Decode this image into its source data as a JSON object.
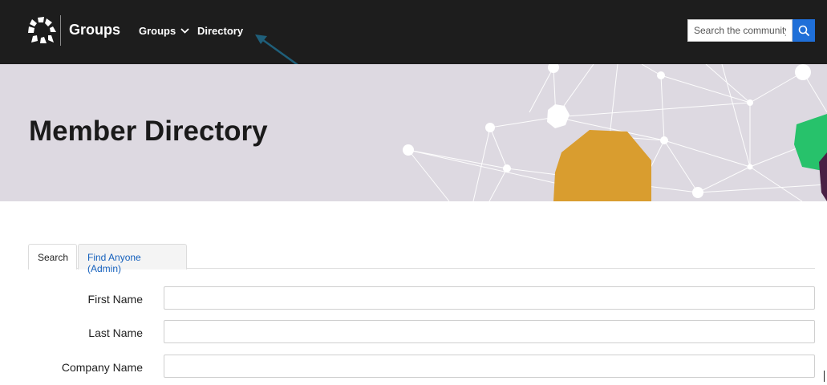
{
  "header": {
    "brand": "Groups",
    "nav": [
      {
        "label": "Groups",
        "has_dropdown": true
      },
      {
        "label": "Directory",
        "has_dropdown": false
      }
    ],
    "search": {
      "placeholder": "Search the community",
      "icon": "search-icon"
    }
  },
  "banner": {
    "title": "Member Directory"
  },
  "tabs": [
    {
      "label": "Search",
      "active": true
    },
    {
      "label": "Find Anyone (Admin)",
      "active": false
    }
  ],
  "form": {
    "fields": [
      {
        "label": "First Name",
        "value": ""
      },
      {
        "label": "Last Name",
        "value": ""
      },
      {
        "label": "Company Name",
        "value": ""
      }
    ]
  },
  "colors": {
    "topbar": "#1d1d1d",
    "banner_bg": "#ddd9e1",
    "accent_blue": "#1f6fd8",
    "arrow": "#1f5f7a",
    "blob_orange": "#d99d2f",
    "blob_green": "#27c26b"
  }
}
